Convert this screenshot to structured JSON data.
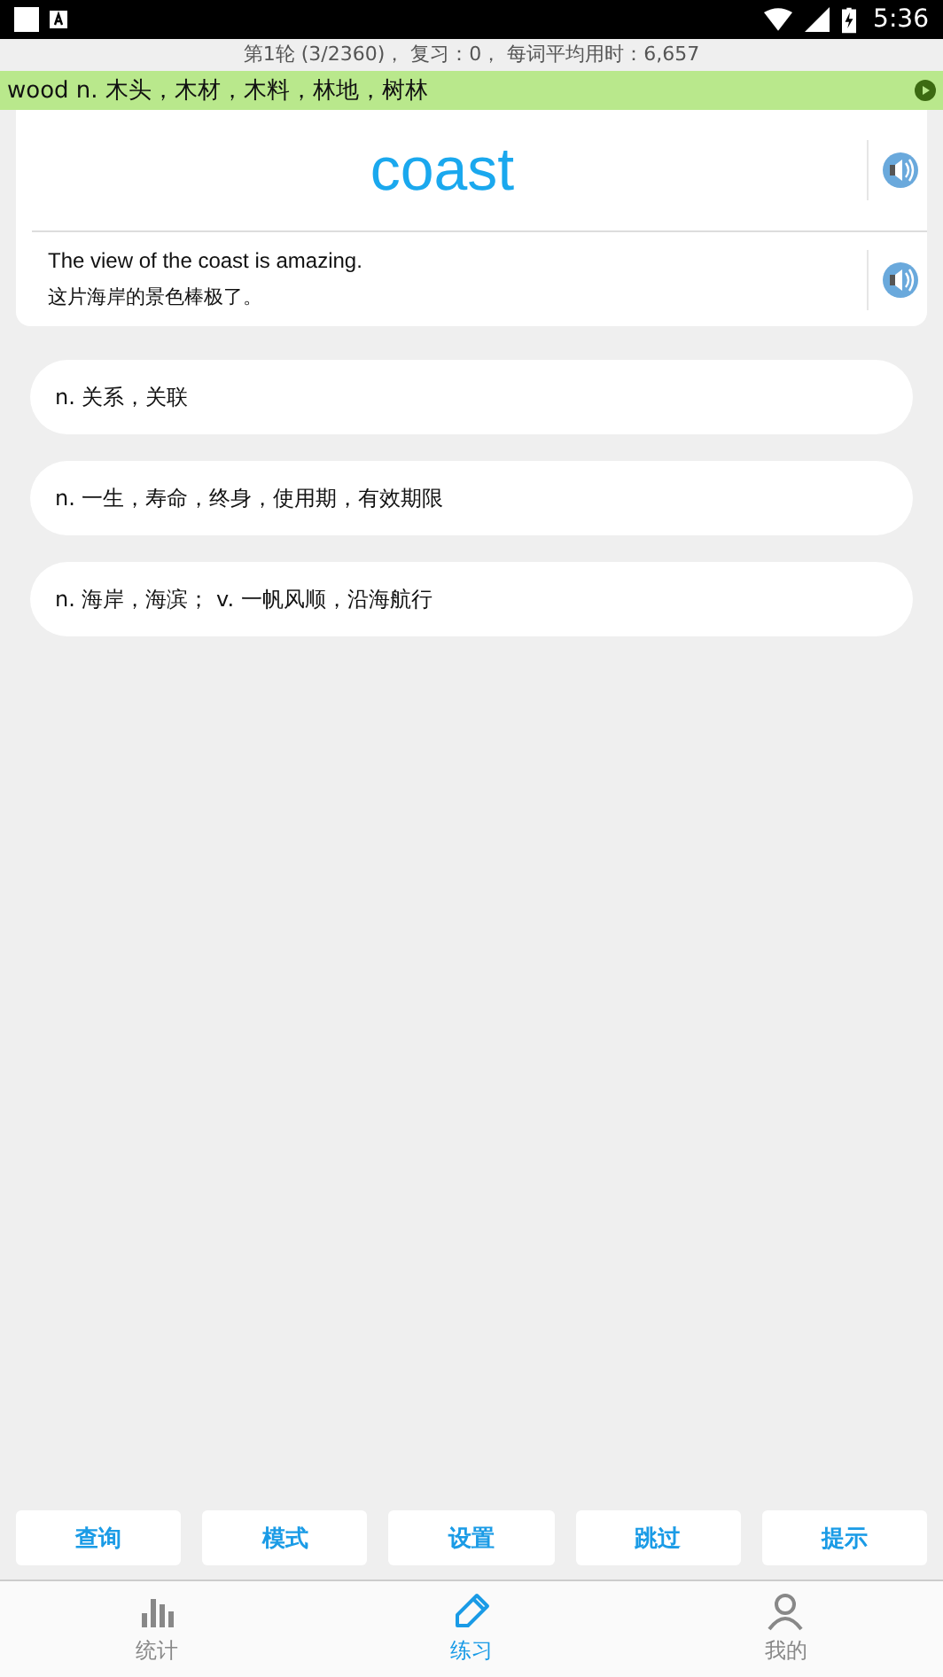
{
  "status_bar": {
    "time": "5:36"
  },
  "progress": "第1轮 (3/2360)， 复习：0， 每词平均用时：6,657",
  "previous": "wood n. 木头，木材，木料，林地，树林",
  "word": "coast",
  "example": {
    "en": "The view of the coast is amazing.",
    "zh": "这片海岸的景色棒极了。"
  },
  "options": [
    "n. 关系，关联",
    "n. 一生，寿命，终身，使用期，有效期限",
    "n. 海岸，海滨； v. 一帆风顺，沿海航行"
  ],
  "actions": [
    "查询",
    "模式",
    "设置",
    "跳过",
    "提示"
  ],
  "tabs": [
    {
      "label": "统计",
      "kind": "stats",
      "selected": false
    },
    {
      "label": "练习",
      "kind": "practice",
      "selected": true
    },
    {
      "label": "我的",
      "kind": "profile",
      "selected": false
    }
  ]
}
